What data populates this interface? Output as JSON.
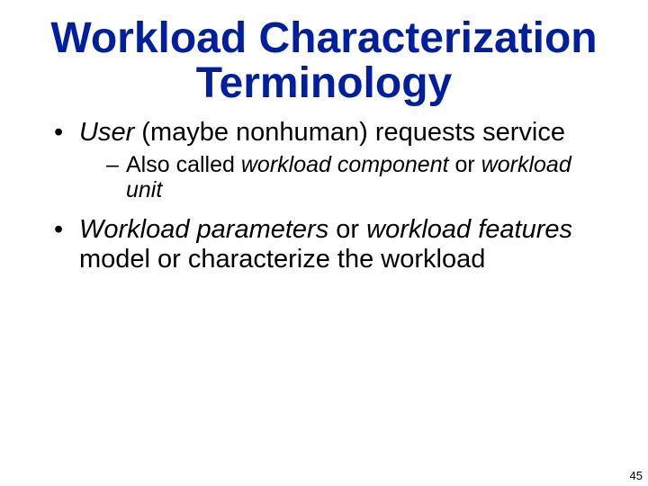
{
  "title": {
    "line1": "Workload Characterization",
    "line2": "Terminology"
  },
  "bullets": [
    {
      "parts": [
        {
          "text": "User",
          "italic": true
        },
        {
          "text": " (maybe nonhuman) requests service",
          "italic": false
        }
      ],
      "sub": [
        {
          "parts": [
            {
              "text": "Also called ",
              "italic": false
            },
            {
              "text": "workload component",
              "italic": true
            },
            {
              "text": " or ",
              "italic": false
            },
            {
              "text": "workload unit",
              "italic": true
            }
          ]
        }
      ]
    },
    {
      "parts": [
        {
          "text": "Workload parameters",
          "italic": true
        },
        {
          "text": " or ",
          "italic": false
        },
        {
          "text": "workload features",
          "italic": true
        },
        {
          "text": " model or characterize the workload",
          "italic": false
        }
      ],
      "sub": []
    }
  ],
  "pageNumber": "45"
}
